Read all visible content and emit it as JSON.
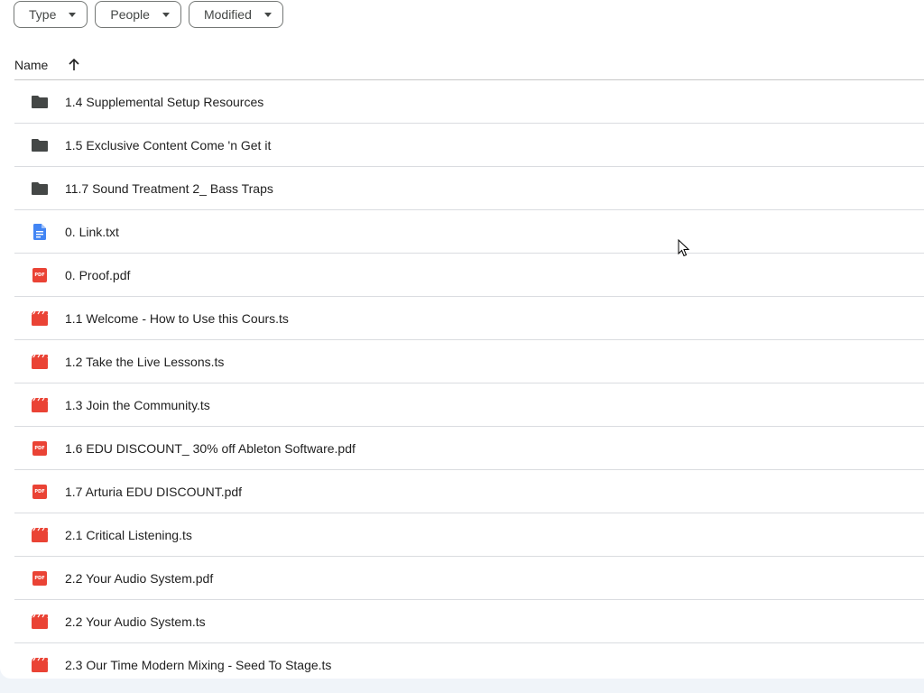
{
  "filters": [
    {
      "label": "Type",
      "icon": "chevron-down-icon"
    },
    {
      "label": "People",
      "icon": "chevron-down-icon"
    },
    {
      "label": "Modified",
      "icon": "chevron-down-icon"
    }
  ],
  "list_header": {
    "name_label": "Name",
    "sort_icon": "arrow-up-icon"
  },
  "files": [
    {
      "name": "1.4 Supplemental Setup Resources",
      "type": "folder"
    },
    {
      "name": "1.5 Exclusive Content Come 'n Get it",
      "type": "folder"
    },
    {
      "name": "11.7 Sound Treatment 2_ Bass Traps",
      "type": "folder"
    },
    {
      "name": "0. Link.txt",
      "type": "doc"
    },
    {
      "name": "0. Proof.pdf",
      "type": "pdf"
    },
    {
      "name": "1.1 Welcome - How to Use this Cours.ts",
      "type": "video"
    },
    {
      "name": "1.2 Take the Live Lessons.ts",
      "type": "video"
    },
    {
      "name": "1.3 Join the Community.ts",
      "type": "video"
    },
    {
      "name": "1.6 EDU DISCOUNT_ 30% off Ableton Software.pdf",
      "type": "pdf"
    },
    {
      "name": "1.7 Arturia EDU DISCOUNT.pdf",
      "type": "pdf"
    },
    {
      "name": "2.1 Critical Listening.ts",
      "type": "video"
    },
    {
      "name": "2.2 Your Audio System.pdf",
      "type": "pdf"
    },
    {
      "name": "2.2 Your Audio System.ts",
      "type": "video"
    },
    {
      "name": "2.3 Our Time Modern Mixing - Seed To Stage.ts",
      "type": "video"
    }
  ],
  "pdf_badge_text": "PDF",
  "colors": {
    "folder": "#444746",
    "doc": "#4285f4",
    "pdf": "#ea4335",
    "video": "#ea4335"
  }
}
